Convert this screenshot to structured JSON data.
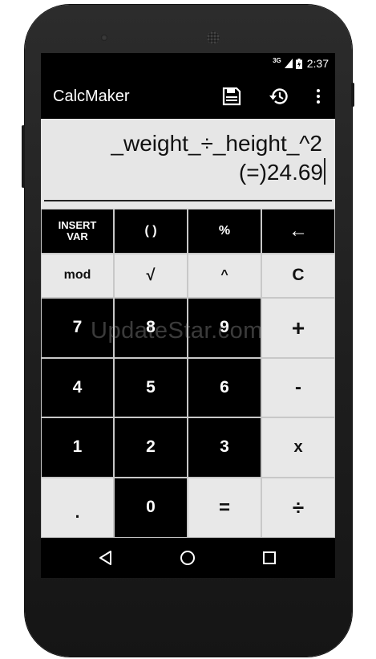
{
  "status_bar": {
    "network": "3G",
    "time": "2:37",
    "icons": [
      "signal-icon",
      "battery-icon"
    ]
  },
  "toolbar": {
    "title": "CalcMaker",
    "actions": [
      "save-icon",
      "history-icon",
      "overflow-menu-icon"
    ]
  },
  "display": {
    "expression": "_weight_÷_height_^2",
    "result": "(=)24.69"
  },
  "keypad": {
    "rows": [
      [
        "INSERT\nVAR",
        "( )",
        "%",
        "←"
      ],
      [
        "mod",
        "√",
        "^",
        "C"
      ],
      [
        "7",
        "8",
        "9",
        "+"
      ],
      [
        "4",
        "5",
        "6",
        "-"
      ],
      [
        "1",
        "2",
        "3",
        "x"
      ],
      [
        ".",
        "0",
        "=",
        "÷"
      ]
    ]
  },
  "watermark": "UpdateStar.com",
  "navigation": {
    "buttons": [
      "back-icon",
      "home-icon",
      "recents-icon"
    ]
  },
  "colors": {
    "key_dark": "#000000",
    "key_light": "#e8e8e8",
    "display_background": "#e6e6e6",
    "app_bar": "#000000",
    "phone_body": "#222222"
  }
}
